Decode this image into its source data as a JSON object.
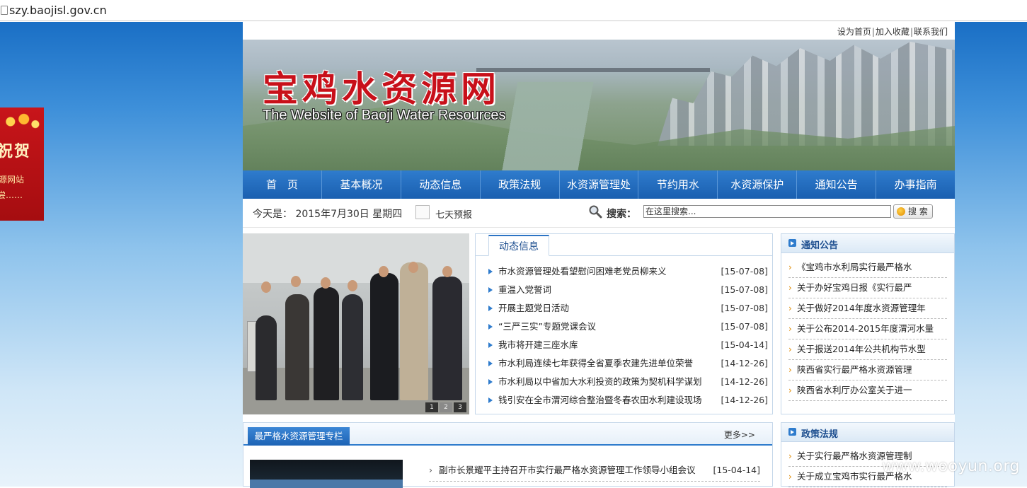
{
  "browser": {
    "url": "szy.baojisl.gov.cn"
  },
  "float_ad": {
    "line1": "祝贺",
    "line2": "源网站",
    "line3": "尝……"
  },
  "toplinks": [
    "设为首页",
    "加入收藏",
    "联系我们"
  ],
  "banner": {
    "title_cn": "宝鸡水资源网",
    "title_en": "The Website of Baoji Water Resources"
  },
  "nav": [
    "首　页",
    "基本概况",
    "动态信息",
    "政策法规",
    "水资源管理处",
    "节约用水",
    "水资源保护",
    "通知公告",
    "办事指南"
  ],
  "infobar": {
    "date": "今天是： 2015年7月30日 星期四",
    "weather": "七天预报",
    "search_label": "搜索：",
    "search_placeholder": "在这里搜索...",
    "search_button": "搜 索"
  },
  "photo": {
    "pager": [
      "1",
      "2",
      "3"
    ],
    "active_page": 2
  },
  "news": {
    "tab": "动态信息",
    "items": [
      {
        "title": "市水资源管理处看望慰问困难老党员柳来义",
        "date": "[15-07-08]"
      },
      {
        "title": "重温入党誓词",
        "date": "[15-07-08]"
      },
      {
        "title": "开展主题党日活动",
        "date": "[15-07-08]"
      },
      {
        "title": "“三严三实”专题党课会议",
        "date": "[15-07-08]"
      },
      {
        "title": "我市将开建三座水库",
        "date": "[15-04-14]"
      },
      {
        "title": "市水利局连续七年获得全省夏季农建先进单位荣誉",
        "date": "[14-12-26]"
      },
      {
        "title": "市水利局以中省加大水利投资的政策为契机科学谋划",
        "date": "[14-12-26]"
      },
      {
        "title": "钱引安在全市渭河综合整治暨冬春农田水利建设现场",
        "date": "[14-12-26]"
      }
    ]
  },
  "notice": {
    "title": "通知公告",
    "items": [
      "《宝鸡市水利局实行最严格水",
      "关于办好宝鸡日报《实行最严",
      "关于做好2014年度水资源管理年",
      "关于公布2014-2015年度渭河水量",
      "关于报送2014年公共机构节水型",
      "陕西省实行最严格水资源管理",
      "陕西省水利厅办公室关于进一"
    ]
  },
  "policy": {
    "title": "政策法规",
    "items": [
      "关于实行最严格水资源管理制",
      "关于成立宝鸡市实行最严格水"
    ]
  },
  "special": {
    "tab": "最严格水资源管理专栏",
    "more": "更多>>",
    "items": [
      {
        "title": "副市长景耀平主持召开市实行最严格水资源管理工作领导小组会议",
        "date": "[15-04-14]"
      }
    ]
  },
  "watermark": "www.wooyun.org"
}
